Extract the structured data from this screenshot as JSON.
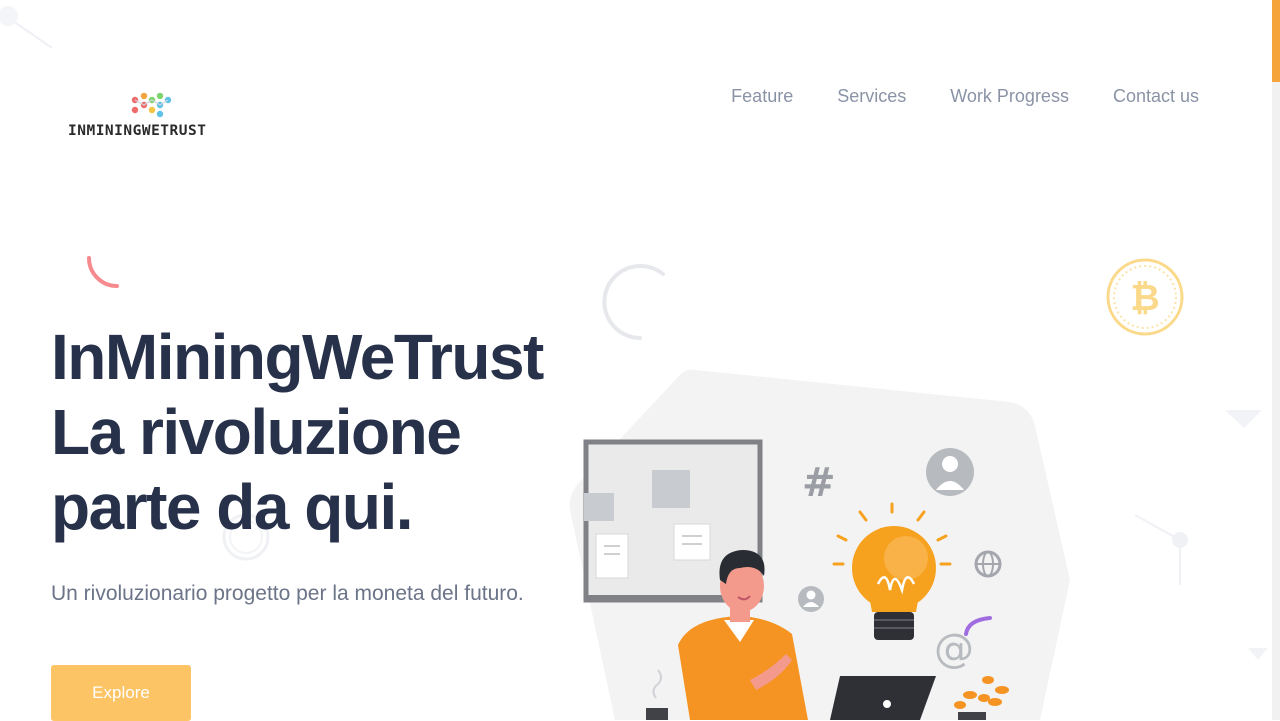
{
  "brand": {
    "name": "INMININGWETRUST"
  },
  "nav": {
    "items": [
      {
        "label": "Feature"
      },
      {
        "label": "Services"
      },
      {
        "label": "Work Progress"
      },
      {
        "label": "Contact us"
      }
    ]
  },
  "hero": {
    "title_lines": [
      "InMiningWeTrust",
      "La rivoluzione",
      "parte da qui."
    ],
    "subtitle": "Un rivoluzionario progetto per la moneta del futuro.",
    "cta_label": "Explore"
  },
  "colors": {
    "accent": "#fdc465",
    "title": "#27314a",
    "nav_text": "#8a93a6",
    "bulb": "#f7a21e",
    "shirt": "#f59423",
    "bitcoin": "#fbd98a"
  }
}
